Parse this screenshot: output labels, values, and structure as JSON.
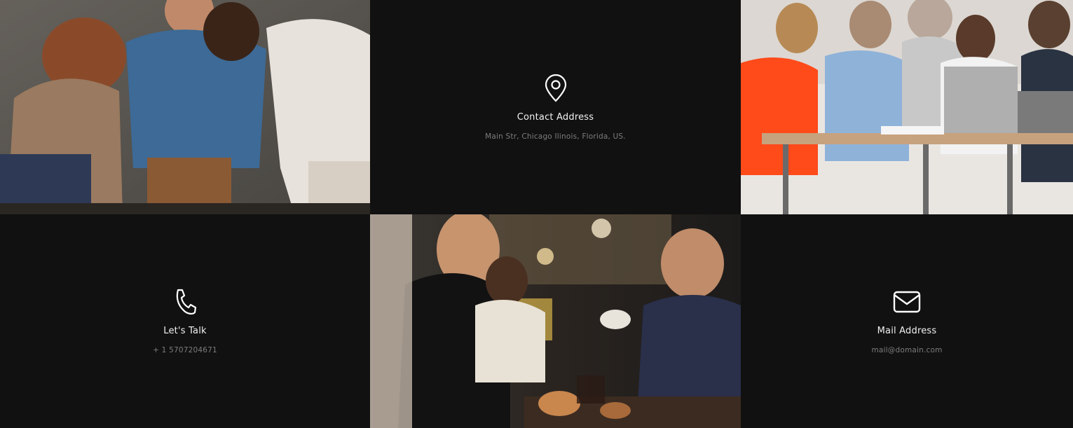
{
  "tiles": {
    "top_left_photo": {
      "icon": "photo-team-at-table"
    },
    "contact": {
      "icon": "map-pin-icon",
      "title": "Contact Address",
      "text": "Main Str, Chicago Ilinois, Florida, US."
    },
    "top_right_photo": {
      "icon": "photo-meeting-table"
    },
    "talk": {
      "icon": "phone-icon",
      "title": "Let's Talk",
      "text": "+ 1 5707204671"
    },
    "center_photo": {
      "icon": "photo-cafe-laughing"
    },
    "mail": {
      "icon": "mail-icon",
      "title": "Mail Address",
      "text": "mail@domain.com"
    }
  },
  "colors": {
    "background": "#111111",
    "title": "#f2f2f2",
    "subtext": "#7d7d7d"
  }
}
